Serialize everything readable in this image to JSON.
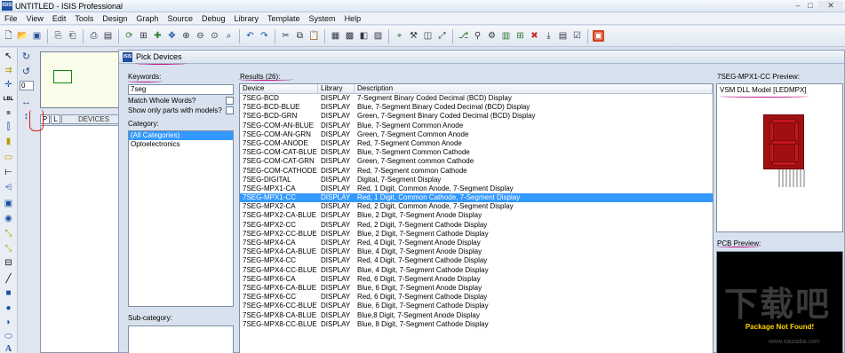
{
  "window": {
    "app_icon": "ISIS",
    "title": "UNTITLED - ISIS Professional",
    "controls": [
      "–",
      "□",
      "✕"
    ]
  },
  "menu": [
    "File",
    "View",
    "Edit",
    "Tools",
    "Design",
    "Graph",
    "Source",
    "Debug",
    "Library",
    "Template",
    "System",
    "Help"
  ],
  "toolbar_icons": [
    "new-file-icon",
    "open-folder-icon",
    "save-icon",
    "import-icon",
    "export-icon",
    "print-icon",
    "printer-setup-icon",
    "refresh-icon",
    "grid-icon",
    "origin-icon",
    "pan-icon",
    "zoom-in-icon",
    "zoom-out-icon",
    "zoom-all-icon",
    "zoom-area-icon",
    "undo-icon",
    "redo-icon",
    "cut-icon",
    "copy-icon",
    "paste-icon",
    "block-copy-icon",
    "block-move-icon",
    "block-rotate-icon",
    "block-delete-icon",
    "pick-device-icon",
    "make-device-icon",
    "packaging-tool-icon",
    "decompose-icon",
    "wire-autorouter-icon",
    "search-tag-icon",
    "property-assignment-icon",
    "design-explorer-icon",
    "new-sheet-icon",
    "remove-sheet-icon",
    "zoom-child-icon",
    "bill-of-materials-icon",
    "electrical-rule-check-icon",
    "netlist-to-ares-icon"
  ],
  "sidebar": {
    "zoom_value": "0",
    "p_label": "P",
    "l_label": "L",
    "devices_label": "DEVICES"
  },
  "dialog": {
    "icon": "ISIS",
    "title": "Pick Devices",
    "keywords_label": "Keywords:",
    "keywords_value": "7seg",
    "match_whole_words_label": "Match Whole Words?",
    "show_only_models_label": "Show only parts with models?",
    "category_label": "Category:",
    "categories": [
      {
        "label": "(All Categories)",
        "selected": true
      },
      {
        "label": "Optoelectronics",
        "selected": false
      }
    ],
    "subcategory_label": "Sub-category:",
    "results_label": "Results (26):",
    "columns": [
      "Device",
      "Library",
      "Description"
    ],
    "results": [
      {
        "device": "7SEG-BCD",
        "library": "DISPLAY",
        "description": "7-Segment Binary Coded Decimal (BCD) Display"
      },
      {
        "device": "7SEG-BCD-BLUE",
        "library": "DISPLAY",
        "description": "Blue, 7-Segment Binary Coded Decimal (BCD) Display"
      },
      {
        "device": "7SEG-BCD-GRN",
        "library": "DISPLAY",
        "description": "Green, 7-Segment Binary Coded Decimal (BCD) Display"
      },
      {
        "device": "7SEG-COM-AN-BLUE",
        "library": "DISPLAY",
        "description": "Blue, 7-Segment Common Anode"
      },
      {
        "device": "7SEG-COM-AN-GRN",
        "library": "DISPLAY",
        "description": "Green, 7-Segment Common Anode"
      },
      {
        "device": "7SEG-COM-ANODE",
        "library": "DISPLAY",
        "description": "Red, 7-Segment Common Anode"
      },
      {
        "device": "7SEG-COM-CAT-BLUE",
        "library": "DISPLAY",
        "description": "Blue, 7-Segment Common Cathode"
      },
      {
        "device": "7SEG-COM-CAT-GRN",
        "library": "DISPLAY",
        "description": "Green, 7-Segment common Cathode"
      },
      {
        "device": "7SEG-COM-CATHODE",
        "library": "DISPLAY",
        "description": "Red, 7-Segment common Cathode"
      },
      {
        "device": "7SEG-DIGITAL",
        "library": "DISPLAY",
        "description": "Digital, 7-Segment Display"
      },
      {
        "device": "7SEG-MPX1-CA",
        "library": "DISPLAY",
        "description": "Red, 1 Digit, Common Anode, 7-Segment Display"
      },
      {
        "device": "7SEG-MPX1-CC",
        "library": "DISPLAY",
        "description": "Red, 1 Digit, Common Cathode, 7-Segment Display",
        "selected": true
      },
      {
        "device": "7SEG-MPX2-CA",
        "library": "DISPLAY",
        "description": "Red, 2 Digit, Common Anode, 7-Segment Display"
      },
      {
        "device": "7SEG-MPX2-CA-BLUE",
        "library": "DISPLAY",
        "description": "Blue, 2 Digit, 7-Segment Anode Display"
      },
      {
        "device": "7SEG-MPX2-CC",
        "library": "DISPLAY",
        "description": "Red, 2 Digit, 7-Segment Cathode Display"
      },
      {
        "device": "7SEG-MPX2-CC-BLUE",
        "library": "DISPLAY",
        "description": "Blue, 2 Digit, 7-Segment Cathode Display"
      },
      {
        "device": "7SEG-MPX4-CA",
        "library": "DISPLAY",
        "description": "Red, 4 Digit, 7-Segment Anode Display"
      },
      {
        "device": "7SEG-MPX4-CA-BLUE",
        "library": "DISPLAY",
        "description": "Blue, 4 Digit, 7-Segment Anode Display"
      },
      {
        "device": "7SEG-MPX4-CC",
        "library": "DISPLAY",
        "description": "Red, 4 Digit, 7-Segment Cathode Display"
      },
      {
        "device": "7SEG-MPX4-CC-BLUE",
        "library": "DISPLAY",
        "description": "Blue, 4 Digit, 7-Segment Cathode Display"
      },
      {
        "device": "7SEG-MPX6-CA",
        "library": "DISPLAY",
        "description": "Red, 6 Digit, 7-Segment Anode Display"
      },
      {
        "device": "7SEG-MPX6-CA-BLUE",
        "library": "DISPLAY",
        "description": "Blue, 6 Digit, 7-Segment Anode Display"
      },
      {
        "device": "7SEG-MPX6-CC",
        "library": "DISPLAY",
        "description": "Red, 6 Digit, 7-Segment Cathode Display"
      },
      {
        "device": "7SEG-MPX6-CC-BLUE",
        "library": "DISPLAY",
        "description": "Blue, 6 Digit, 7-Segment Cathode Display"
      },
      {
        "device": "7SEG-MPX8-CA-BLUE",
        "library": "DISPLAY",
        "description": "Blue,8 Digit, 7-Segment Anode Display"
      },
      {
        "device": "7SEG-MPX8-CC-BLUE",
        "library": "DISPLAY",
        "description": "Blue, 8 Digit, 7-Segment Cathode Display"
      }
    ],
    "preview_label": "7SEG-MPX1-CC Preview:",
    "model_label": "VSM DLL Model [LEDMPX]",
    "pcb_preview_label": "PCB Preview:",
    "pcb_message": "Package Not Found!",
    "watermark": "下载吧",
    "watermark_url": "www.xiazaiba.com"
  },
  "colors": {
    "selection": "#3399ff",
    "annotation_magenta": "#c0168a",
    "annotation_red": "#e01818",
    "segment_red": "#c4171b",
    "pcb_message": "#ffd400"
  }
}
